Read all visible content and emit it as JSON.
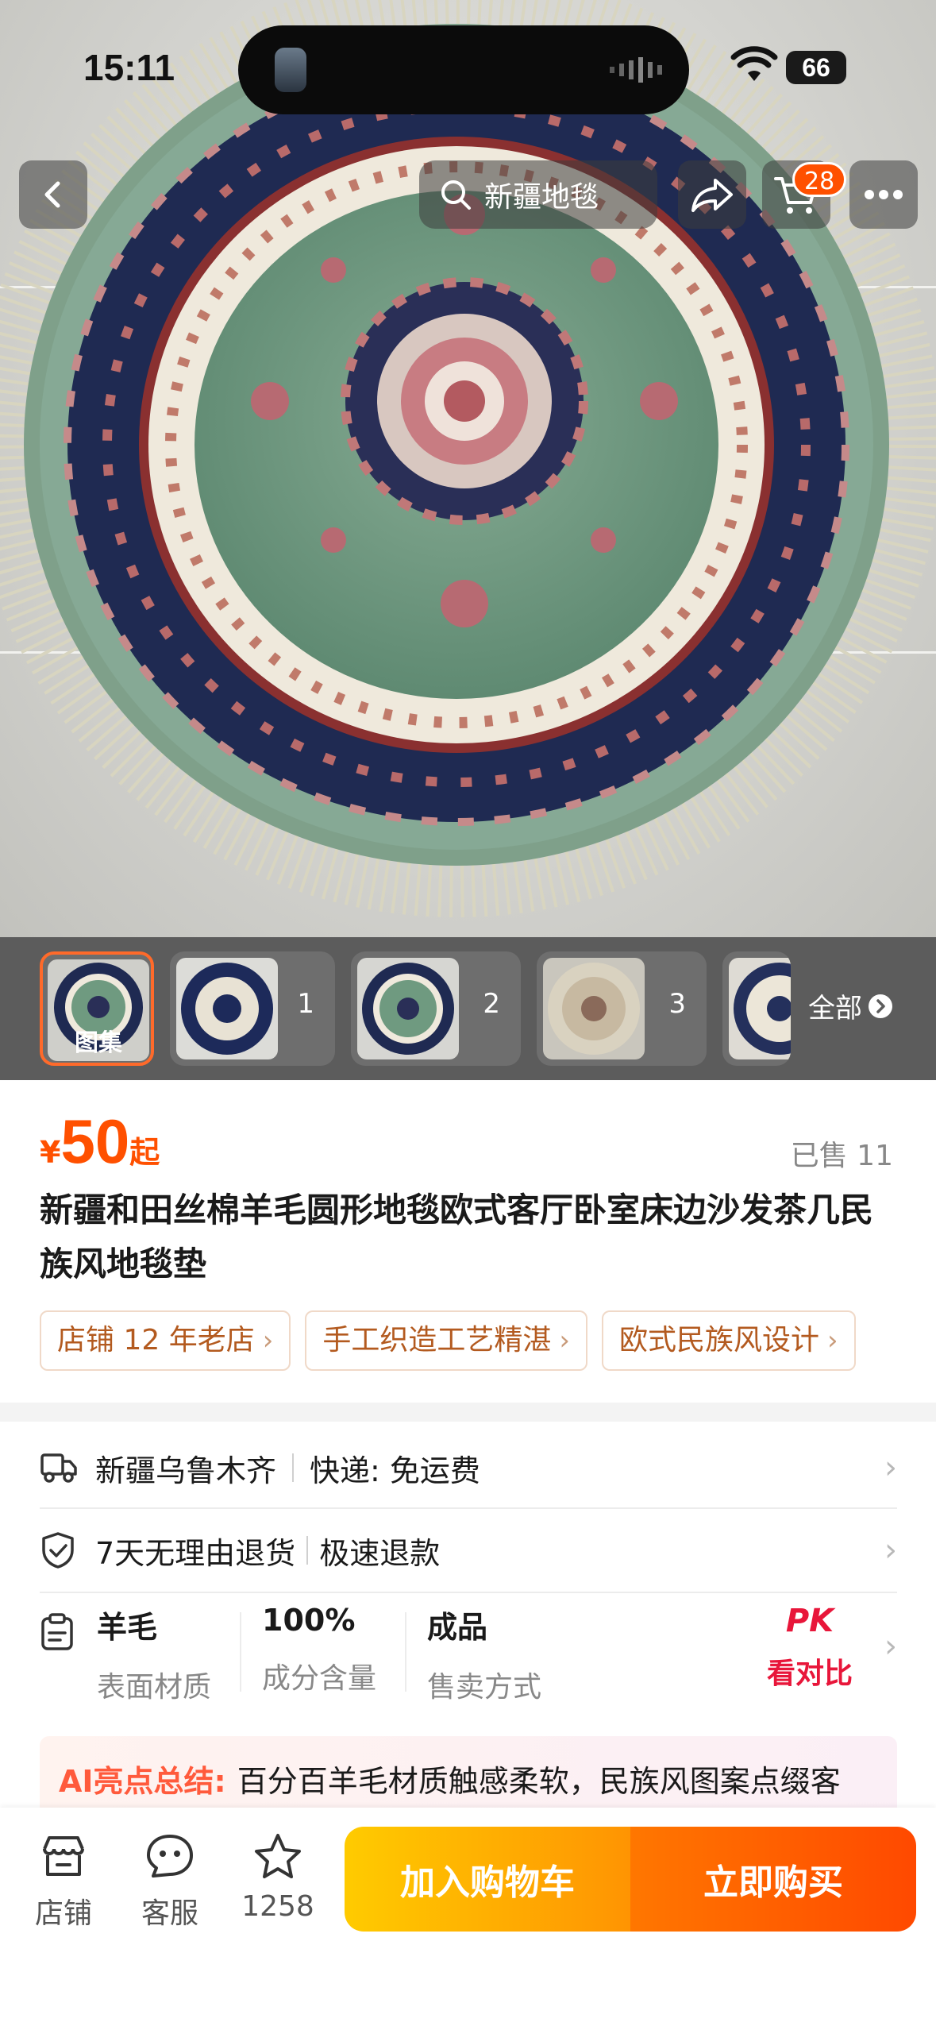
{
  "status_bar": {
    "time": "15:11",
    "battery": "66"
  },
  "nav": {
    "search_text": "新疆地毯",
    "cart_badge": "28"
  },
  "gallery": {
    "thumbs": [
      {
        "label": "图集"
      },
      {
        "label": "1"
      },
      {
        "label": "2"
      },
      {
        "label": "3"
      }
    ],
    "all_label": "全部"
  },
  "product": {
    "price_symbol": "¥",
    "price": "50",
    "price_suffix": "起",
    "sold": "已售 11",
    "title": "新疆和田丝棉羊毛圆形地毯欧式客厅卧室床边沙发茶几民族风地毯垫",
    "tags": [
      "店铺 12 年老店",
      "手工织造工艺精湛",
      "欧式民族风设计"
    ]
  },
  "shipping": {
    "origin": "新疆乌鲁木齐",
    "method": "快递: 免运费"
  },
  "service": {
    "returns": "7天无理由退货",
    "refund": "极速退款"
  },
  "attributes": [
    {
      "value": "羊毛",
      "key": "表面材质"
    },
    {
      "value": "100%",
      "key": "成分含量"
    },
    {
      "value": "成品",
      "key": "售卖方式"
    }
  ],
  "compare": {
    "pk": "PK",
    "label": "看对比"
  },
  "ai_summary": {
    "label": "AI亮点总结:",
    "text": "百分百羊毛材质触感柔软，民族风图案点缀客"
  },
  "bottom_bar": {
    "shop": "店铺",
    "service": "客服",
    "favorites": "1258",
    "add_to_cart": "加入购物车",
    "buy_now": "立即购买"
  },
  "colors": {
    "accent": "#ff5000",
    "cart_button": "#ffa800",
    "buy_button": "#ff5a00",
    "rug_green": "#6f9a80",
    "rug_navy": "#1f2a52"
  }
}
